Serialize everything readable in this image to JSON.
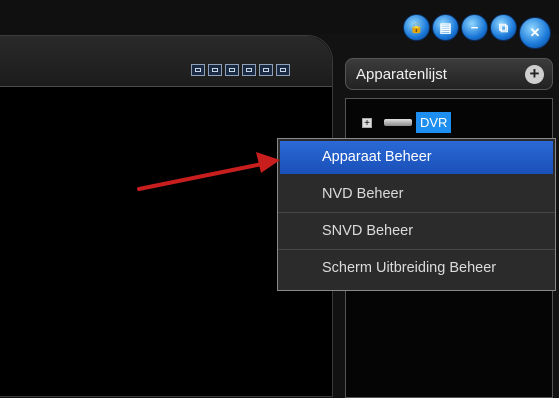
{
  "window_controls": {
    "lock_label": "🔒",
    "list_label": "▤",
    "minimize_label": "−",
    "restore_label": "⧉",
    "close_label": "✕"
  },
  "toolbar": {
    "icons": [
      "layout-icon",
      "grid-icon",
      "split-icon",
      "fullscreen-icon",
      "audio-icon",
      "close-view-icon"
    ]
  },
  "device_panel": {
    "title": "Apparatenlijst",
    "add_symbol": "+",
    "tree": {
      "expand_symbol": "+",
      "device_label": "DVR"
    }
  },
  "context_menu": {
    "items": [
      "Apparaat Beheer",
      "NVD Beheer",
      "SNVD Beheer",
      "Scherm Uitbreiding Beheer"
    ],
    "highlighted_index": 0
  },
  "colors": {
    "accent": "#1a4fb8",
    "arrow": "#c81e1e",
    "panel_bg": "#000000"
  }
}
